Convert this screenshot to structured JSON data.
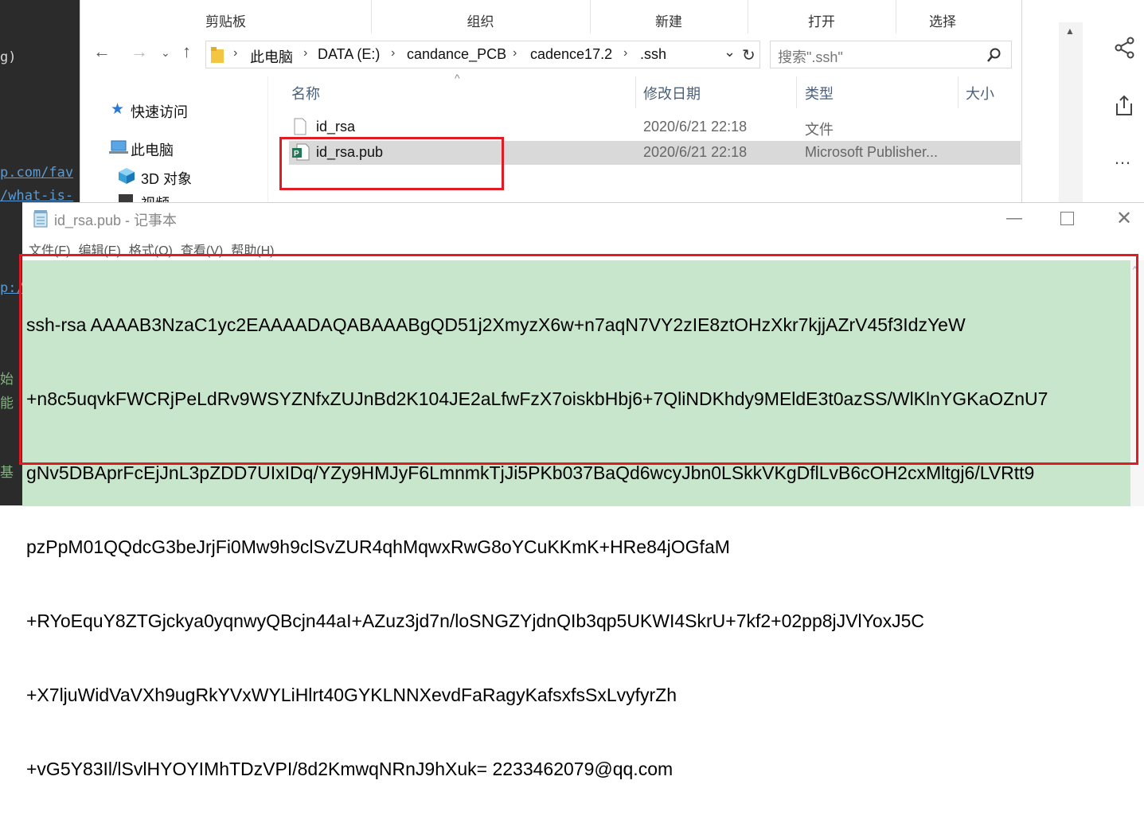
{
  "background_editor": {
    "lines": [
      {
        "text": "g)",
        "color": "#d8d8d8"
      },
      {
        "text": "p.com/fav",
        "color": "#5a9bd4"
      },
      {
        "text": "/what-is-",
        "color": "#5a9bd4"
      },
      {
        "text": "p:/",
        "color": "#5a9bd4"
      },
      {
        "text": "始",
        "color": "#7fb27f"
      },
      {
        "text": "能",
        "color": "#7fb27f"
      },
      {
        "text": "基",
        "color": "#7fb27f"
      }
    ]
  },
  "explorer": {
    "ribbon": [
      "剪贴板",
      "组织",
      "新建",
      "打开",
      "选择"
    ],
    "address": {
      "crumbs": [
        "此电脑",
        "DATA (E:)",
        "candance_PCB",
        "cadence17.2",
        ".ssh"
      ]
    },
    "search_placeholder": "搜索\".ssh\"",
    "nav": {
      "quick_access": "快速访问",
      "this_pc": "此电脑",
      "objects_3d": "3D 对象",
      "videos": "视频"
    },
    "columns": {
      "name": "名称",
      "modified": "修改日期",
      "type": "类型",
      "size": "大小"
    },
    "files": [
      {
        "name": "id_rsa",
        "modified": "2020/6/21 22:18",
        "type": "文件",
        "selected": false
      },
      {
        "name": "id_rsa.pub",
        "modified": "2020/6/21 22:18",
        "type": "Microsoft Publisher...",
        "selected": true
      }
    ]
  },
  "notepad": {
    "title": "id_rsa.pub - 记事本",
    "menu": [
      "文件(F)",
      "编辑(E)",
      "格式(O)",
      "查看(V)",
      "帮助(H)"
    ],
    "content_lines": [
      "ssh-rsa AAAAB3NzaC1yc2EAAAADAQABAAABgQD51j2XmyzX6w+n7aqN7VY2zIE8ztOHzXkr7kjjAZrV45f3IdzYeW",
      "+n8c5uqvkFWCRjPeLdRv9WSYZNfxZUJnBd2K104JE2aLfwFzX7oiskbHbj6+7QliNDKhdy9MEldE3t0azSS/WlKlnYGKaOZnU7",
      "gNv5DBAprFcEjJnL3pZDD7UIxIDq/YZy9HMJyF6LmnmkTjJi5PKb037BaQd6wcyJbn0LSkkVKgDflLvB6cOH2cxMltgj6/LVRtt9",
      "pzPpM01QQdcG3beJrjFi0Mw9h9clSvZUR4qhMqwxRwG8oYCuKKmK+HRe84jOGfaM",
      "+RYoEquY8ZTGjckya0yqnwyQBcjn44aI+AZuz3jd7n/loSNGZYjdnQIb3qp5UKWI4SkrU+7kf2+02pp8jJVlYoxJ5C",
      "+X7ljuWidVaVXh9ugRkYVxWYLiHlrt40GYKLNNXevdFaRagyKafsxfsSxLvyfyrZh",
      "+vG5Y83Il/lSvlHYOYIMhTDzVPI/8d2KmwqNRnJ9hXuk= 2233462079@qq.com"
    ],
    "highlight_color": "#c8e6cb"
  },
  "annotation_color": "#e01b24"
}
